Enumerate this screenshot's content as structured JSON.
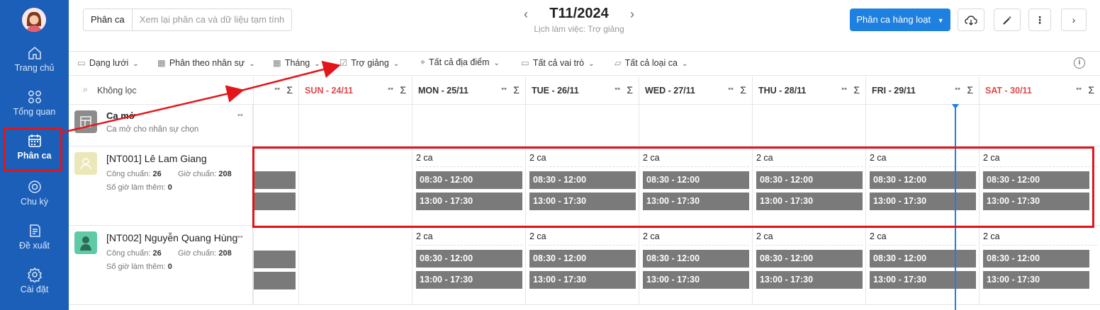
{
  "sidebar": {
    "items": [
      {
        "label": "Trang chủ",
        "icon": "home-icon"
      },
      {
        "label": "Tổng quan",
        "icon": "grid-icon"
      },
      {
        "label": "Phân ca",
        "icon": "calendar-icon"
      },
      {
        "label": "Chu kỳ",
        "icon": "cycle-icon"
      },
      {
        "label": "Đề xuất",
        "icon": "document-icon"
      },
      {
        "label": "Cài đặt",
        "icon": "gear-icon"
      }
    ]
  },
  "header": {
    "segment_label": "Phân ca",
    "segment_placeholder": "Xem lại phân ca và dữ liệu tạm tính",
    "month": "T11/2024",
    "subtitle": "Lịch làm việc: Trợ giảng",
    "bulk_button": "Phân ca hàng loạt"
  },
  "toolbar": {
    "items": [
      {
        "label": "Dạng lưới"
      },
      {
        "label": "Phân theo nhân sự"
      },
      {
        "label": "Tháng"
      },
      {
        "label": "Trợ giảng"
      },
      {
        "label": "Tất cả địa điểm"
      },
      {
        "label": "Tất cả vai trò"
      },
      {
        "label": "Tất cả loại ca"
      }
    ]
  },
  "filter": {
    "label": "Không lọc"
  },
  "days": [
    {
      "label": ""
    },
    {
      "label": "SUN - 24/11"
    },
    {
      "label": "MON - 25/11"
    },
    {
      "label": "TUE - 26/11"
    },
    {
      "label": "WED - 27/11"
    },
    {
      "label": "THU - 28/11"
    },
    {
      "label": "FRI - 29/11"
    },
    {
      "label": "SAT - 30/11"
    }
  ],
  "open_shift": {
    "name": "Ca mở",
    "desc": "Ca mở cho nhân sự chọn"
  },
  "employees": [
    {
      "name": "[NT001] Lê Lam Giang",
      "cong_label": "Công chuẩn:",
      "cong": "26",
      "gio_label": "Giờ chuẩn:",
      "gio": "208",
      "ot_label": "Số giờ làm thêm:",
      "ot": "0",
      "count": "2 ca",
      "shifts": [
        "08:30 - 12:00",
        "13:00 - 17:30"
      ]
    },
    {
      "name": "[NT002] Nguyễn Quang Hùng",
      "cong_label": "Công chuẩn:",
      "cong": "26",
      "gio_label": "Giờ chuẩn:",
      "gio": "208",
      "ot_label": "Số giờ làm thêm:",
      "ot": "0",
      "count": "2 ca",
      "shifts": [
        "08:30 - 12:00",
        "13:00 - 17:30"
      ]
    }
  ],
  "colors": {
    "sidebar": "#1c5fb8",
    "primary": "#1e80e0",
    "shift": "#7a7a7a",
    "highlight": "#e4141b",
    "weekend": "#e04848"
  }
}
